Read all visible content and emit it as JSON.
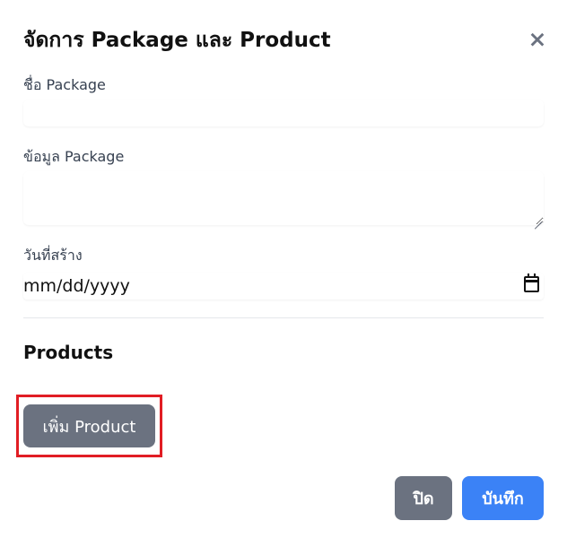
{
  "modal": {
    "title": "จัดการ Package และ Product",
    "close_icon": "×"
  },
  "form": {
    "name": {
      "label": "ชื่อ Package",
      "value": ""
    },
    "info": {
      "label": "ข้อมูล Package",
      "value": ""
    },
    "created": {
      "label": "วันที่สร้าง",
      "display": "mm/dd/yyyy"
    }
  },
  "products": {
    "title": "Products",
    "add_label": "เพิ่ม Product",
    "highlight_color": "#e11d24"
  },
  "footer": {
    "close_label": "ปิด",
    "save_label": "บันทึก",
    "save_color": "#3b82f6",
    "secondary_color": "#6b7280"
  },
  "icons": [
    "close-icon",
    "calendar-icon",
    "resize-handle-icon"
  ]
}
